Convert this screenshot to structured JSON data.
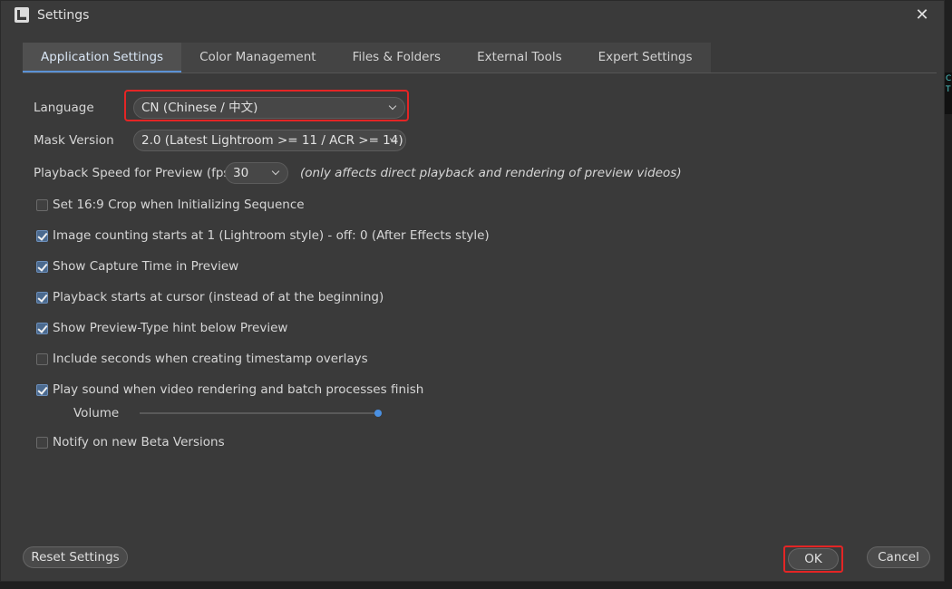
{
  "window": {
    "title": "Settings"
  },
  "tabs": [
    {
      "label": "Application Settings",
      "active": true
    },
    {
      "label": "Color Management",
      "active": false
    },
    {
      "label": "Files & Folders",
      "active": false
    },
    {
      "label": "External Tools",
      "active": false
    },
    {
      "label": "Expert Settings",
      "active": false
    }
  ],
  "fields": {
    "language": {
      "label": "Language",
      "value": "CN (Chinese / 中文)"
    },
    "mask_version": {
      "label": "Mask Version",
      "value": "2.0 (Latest Lightroom >= 11 / ACR >= 14)"
    },
    "playback_speed": {
      "label": "Playback Speed for Preview (fps)",
      "value": "30",
      "note": "(only affects direct playback and rendering of preview videos)"
    }
  },
  "checkboxes": [
    {
      "label": "Set 16:9 Crop when Initializing Sequence",
      "checked": false
    },
    {
      "label": "Image counting starts at 1 (Lightroom style) - off: 0 (After Effects style)",
      "checked": true
    },
    {
      "label": "Show Capture Time in Preview",
      "checked": true
    },
    {
      "label": "Playback starts at cursor (instead of at the beginning)",
      "checked": true
    },
    {
      "label": "Show Preview-Type hint below Preview",
      "checked": true
    },
    {
      "label": "Include seconds when creating timestamp overlays",
      "checked": false
    },
    {
      "label": "Play sound when video rendering and batch processes finish",
      "checked": true
    },
    {
      "label": "Notify on new Beta Versions",
      "checked": false
    }
  ],
  "volume": {
    "label": "Volume",
    "value_fraction": 1.0
  },
  "buttons": {
    "reset": "Reset Settings",
    "ok": "OK",
    "cancel": "Cancel"
  },
  "side_strip": {
    "line1": "C",
    "line2": "T"
  },
  "colors": {
    "accent": "#4a90e2",
    "highlight": "#e42525",
    "background": "#3a3a3a"
  }
}
